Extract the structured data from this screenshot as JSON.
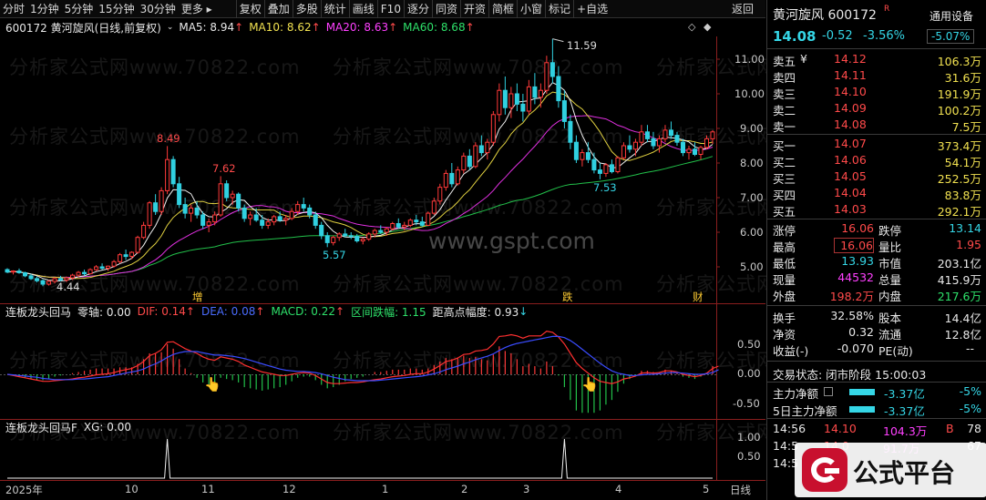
{
  "toolbar": {
    "left": [
      "分时",
      "1分钟",
      "5分钟",
      "15分钟",
      "30分钟",
      "更多 ▸"
    ],
    "right": [
      "复权",
      "叠加",
      "多股",
      "统计",
      "画线",
      "F10",
      "逐分",
      "同资",
      "开资",
      "简框",
      "小窗",
      "标记",
      "+自选"
    ],
    "return": "返回"
  },
  "info": {
    "code_name": "600172 黄河旋风(日线,前复权)",
    "ma5": "MA5: 8.94",
    "ma10": "MA10: 8.62",
    "ma20": "MA20: 8.63",
    "ma60": "MA60: 8.68"
  },
  "watermarks": {
    "text": "分析家公式网www.70822.com",
    "site": "www.gspt.com",
    "logo_text": "公式平台"
  },
  "price_axis": [
    "11.00",
    "10.00",
    "9.00",
    "8.00",
    "7.00",
    "6.00",
    "5.00"
  ],
  "price_labels": [
    "11.59",
    "8.49",
    "7.62",
    "5.57",
    "4.44",
    "7.53"
  ],
  "markers": [
    "增",
    "跌",
    "财"
  ],
  "indicator1": {
    "name": "连板龙头回马",
    "zero": "零轴: 0.00",
    "dif": "DIF: 0.14",
    "dea": "DEA: 0.08",
    "macd": "MACD: 0.22",
    "range": "区间跌幅: 1.15",
    "dist": "距高点幅度: 0.93",
    "axis": [
      "0.50",
      "0.00",
      "-0.50"
    ]
  },
  "indicator2": {
    "name": "连板龙头回马F",
    "xg": "XG: 0.00",
    "axis": [
      "1.00",
      "0.50"
    ]
  },
  "date_axis": [
    "2025年",
    "10",
    "11",
    "12",
    "1",
    "2",
    "3",
    "4",
    "5"
  ],
  "period": "日线",
  "chart_data": {
    "type": "candlestick",
    "y_range": [
      4.2,
      12.0
    ],
    "candles": [
      [
        4.92,
        4.96,
        4.82,
        4.85
      ],
      [
        4.85,
        4.9,
        4.78,
        4.88
      ],
      [
        4.88,
        4.95,
        4.8,
        4.83
      ],
      [
        4.83,
        4.86,
        4.7,
        4.74
      ],
      [
        4.74,
        4.8,
        4.62,
        4.66
      ],
      [
        4.66,
        4.72,
        4.55,
        4.6
      ],
      [
        4.6,
        4.64,
        4.44,
        4.5
      ],
      [
        4.5,
        4.62,
        4.46,
        4.58
      ],
      [
        4.58,
        4.7,
        4.52,
        4.66
      ],
      [
        4.66,
        4.74,
        4.58,
        4.62
      ],
      [
        4.62,
        4.72,
        4.56,
        4.68
      ],
      [
        4.68,
        4.8,
        4.62,
        4.76
      ],
      [
        4.76,
        4.88,
        4.7,
        4.84
      ],
      [
        4.84,
        4.92,
        4.74,
        4.8
      ],
      [
        4.8,
        4.96,
        4.78,
        4.92
      ],
      [
        4.92,
        5.05,
        4.88,
        5.0
      ],
      [
        5.0,
        5.1,
        4.92,
        4.96
      ],
      [
        4.96,
        5.04,
        4.88,
        5.02
      ],
      [
        5.02,
        5.2,
        4.98,
        5.15
      ],
      [
        5.15,
        5.4,
        5.1,
        5.35
      ],
      [
        5.35,
        5.5,
        5.2,
        5.3
      ],
      [
        5.3,
        5.45,
        5.22,
        5.42
      ],
      [
        5.42,
        5.9,
        5.38,
        5.85
      ],
      [
        5.85,
        6.3,
        5.8,
        6.2
      ],
      [
        6.2,
        6.9,
        6.1,
        6.85
      ],
      [
        6.85,
        7.1,
        6.5,
        6.6
      ],
      [
        6.6,
        7.3,
        6.5,
        7.2
      ],
      [
        7.2,
        8.49,
        7.1,
        8.1
      ],
      [
        8.1,
        8.2,
        7.3,
        7.4
      ],
      [
        7.4,
        7.6,
        6.7,
        6.8
      ],
      [
        6.8,
        7.0,
        6.4,
        6.55
      ],
      [
        6.55,
        6.8,
        6.3,
        6.7
      ],
      [
        6.7,
        6.9,
        6.4,
        6.5
      ],
      [
        6.5,
        6.6,
        6.1,
        6.2
      ],
      [
        6.2,
        6.4,
        6.0,
        6.3
      ],
      [
        6.3,
        6.6,
        6.2,
        6.5
      ],
      [
        6.5,
        7.62,
        6.45,
        7.4
      ],
      [
        7.4,
        7.5,
        6.9,
        7.0
      ],
      [
        7.0,
        7.2,
        6.8,
        7.1
      ],
      [
        7.1,
        7.15,
        6.6,
        6.7
      ],
      [
        6.7,
        6.8,
        6.3,
        6.4
      ],
      [
        6.4,
        6.6,
        6.2,
        6.5
      ],
      [
        6.5,
        6.7,
        6.3,
        6.35
      ],
      [
        6.35,
        6.5,
        6.1,
        6.2
      ],
      [
        6.2,
        6.4,
        6.1,
        6.3
      ],
      [
        6.3,
        6.5,
        6.2,
        6.45
      ],
      [
        6.45,
        6.6,
        6.3,
        6.35
      ],
      [
        6.35,
        6.5,
        6.2,
        6.4
      ],
      [
        6.4,
        6.7,
        6.35,
        6.6
      ],
      [
        6.6,
        6.9,
        6.5,
        6.8
      ],
      [
        6.8,
        7.0,
        6.6,
        6.7
      ],
      [
        6.7,
        6.8,
        6.4,
        6.5
      ],
      [
        6.5,
        6.6,
        6.1,
        6.2
      ],
      [
        6.2,
        6.3,
        5.8,
        5.9
      ],
      [
        5.9,
        6.0,
        5.57,
        5.7
      ],
      [
        5.7,
        5.9,
        5.62,
        5.85
      ],
      [
        5.85,
        6.0,
        5.75,
        5.95
      ],
      [
        5.95,
        6.1,
        5.85,
        5.9
      ],
      [
        5.9,
        6.0,
        5.8,
        5.88
      ],
      [
        5.88,
        5.95,
        5.7,
        5.75
      ],
      [
        5.75,
        5.85,
        5.65,
        5.8
      ],
      [
        5.8,
        6.0,
        5.75,
        5.95
      ],
      [
        5.95,
        6.1,
        5.85,
        6.05
      ],
      [
        6.05,
        6.2,
        5.95,
        6.0
      ],
      [
        6.0,
        6.15,
        5.9,
        6.1
      ],
      [
        6.1,
        6.3,
        6.05,
        6.25
      ],
      [
        6.25,
        6.4,
        6.1,
        6.15
      ],
      [
        6.15,
        6.3,
        6.05,
        6.2
      ],
      [
        6.2,
        6.4,
        6.15,
        6.35
      ],
      [
        6.35,
        6.5,
        6.2,
        6.3
      ],
      [
        6.3,
        6.45,
        6.15,
        6.2
      ],
      [
        6.2,
        6.6,
        6.18,
        6.55
      ],
      [
        6.55,
        7.0,
        6.5,
        6.9
      ],
      [
        6.9,
        7.4,
        6.8,
        7.3
      ],
      [
        7.3,
        7.8,
        7.2,
        7.7
      ],
      [
        7.7,
        8.0,
        7.3,
        7.4
      ],
      [
        7.4,
        7.9,
        7.35,
        7.8
      ],
      [
        7.8,
        8.3,
        7.7,
        8.2
      ],
      [
        8.2,
        8.4,
        7.8,
        7.9
      ],
      [
        7.9,
        8.6,
        7.85,
        8.5
      ],
      [
        8.5,
        8.8,
        8.2,
        8.3
      ],
      [
        8.3,
        8.7,
        8.1,
        8.6
      ],
      [
        8.6,
        9.5,
        8.5,
        9.4
      ],
      [
        9.4,
        10.3,
        9.2,
        10.1
      ],
      [
        10.1,
        10.5,
        9.4,
        9.6
      ],
      [
        9.6,
        10.2,
        9.3,
        10.0
      ],
      [
        10.0,
        10.3,
        9.5,
        9.7
      ],
      [
        9.7,
        10.0,
        9.2,
        9.5
      ],
      [
        9.5,
        10.4,
        9.4,
        10.2
      ],
      [
        10.2,
        10.6,
        9.7,
        9.9
      ],
      [
        9.9,
        10.3,
        9.6,
        10.1
      ],
      [
        10.1,
        11.1,
        10.0,
        10.9
      ],
      [
        10.9,
        11.59,
        10.3,
        10.5
      ],
      [
        10.5,
        10.8,
        9.6,
        9.8
      ],
      [
        9.8,
        10.1,
        9.0,
        9.2
      ],
      [
        9.2,
        9.4,
        8.4,
        8.6
      ],
      [
        8.6,
        8.8,
        8.0,
        8.1
      ],
      [
        8.1,
        8.4,
        7.9,
        8.3
      ],
      [
        8.3,
        8.6,
        8.0,
        8.1
      ],
      [
        8.1,
        8.3,
        7.7,
        7.8
      ],
      [
        7.8,
        8.0,
        7.53,
        7.7
      ],
      [
        7.7,
        8.0,
        7.6,
        7.95
      ],
      [
        7.95,
        8.1,
        7.7,
        7.75
      ],
      [
        7.75,
        8.2,
        7.7,
        8.15
      ],
      [
        8.15,
        8.6,
        8.1,
        8.5
      ],
      [
        8.5,
        8.8,
        8.3,
        8.4
      ],
      [
        8.4,
        8.7,
        8.2,
        8.6
      ],
      [
        8.6,
        9.1,
        8.5,
        8.9
      ],
      [
        8.9,
        9.1,
        8.6,
        8.7
      ],
      [
        8.7,
        8.9,
        8.4,
        8.5
      ],
      [
        8.5,
        8.8,
        8.3,
        8.7
      ],
      [
        8.7,
        9.1,
        8.6,
        8.95
      ],
      [
        8.95,
        9.2,
        8.7,
        8.8
      ],
      [
        8.8,
        8.9,
        8.5,
        8.6
      ],
      [
        8.6,
        8.7,
        8.2,
        8.3
      ],
      [
        8.3,
        8.5,
        8.1,
        8.4
      ],
      [
        8.4,
        8.6,
        8.2,
        8.25
      ],
      [
        8.25,
        8.5,
        8.1,
        8.45
      ],
      [
        8.45,
        8.8,
        8.4,
        8.7
      ],
      [
        8.7,
        8.95,
        8.55,
        8.9
      ]
    ],
    "dif": [
      0.0,
      -0.02,
      -0.04,
      -0.06,
      -0.08,
      -0.1,
      -0.12,
      -0.12,
      -0.11,
      -0.1,
      -0.09,
      -0.08,
      -0.06,
      -0.05,
      -0.03,
      -0.01,
      0.0,
      0.01,
      0.03,
      0.06,
      0.08,
      0.1,
      0.15,
      0.22,
      0.32,
      0.36,
      0.42,
      0.55,
      0.56,
      0.5,
      0.44,
      0.4,
      0.36,
      0.3,
      0.26,
      0.24,
      0.3,
      0.28,
      0.26,
      0.22,
      0.16,
      0.12,
      0.08,
      0.04,
      0.02,
      0.0,
      -0.02,
      -0.02,
      0.0,
      0.02,
      0.03,
      0.02,
      -0.02,
      -0.08,
      -0.14,
      -0.16,
      -0.16,
      -0.15,
      -0.14,
      -0.14,
      -0.13,
      -0.11,
      -0.09,
      -0.08,
      -0.06,
      -0.04,
      -0.03,
      -0.02,
      0.0,
      0.01,
      0.01,
      0.04,
      0.09,
      0.15,
      0.22,
      0.24,
      0.28,
      0.34,
      0.35,
      0.4,
      0.41,
      0.43,
      0.52,
      0.65,
      0.66,
      0.68,
      0.66,
      0.62,
      0.66,
      0.66,
      0.66,
      0.74,
      0.72,
      0.64,
      0.52,
      0.36,
      0.2,
      0.1,
      0.02,
      -0.06,
      -0.12,
      -0.14,
      -0.16,
      -0.13,
      -0.08,
      -0.06,
      -0.03,
      0.02,
      0.03,
      0.02,
      0.03,
      0.06,
      0.06,
      0.04,
      0.0,
      -0.02,
      -0.04,
      -0.02,
      0.02,
      0.1,
      0.14
    ],
    "dea": [
      0.0,
      -0.01,
      -0.02,
      -0.03,
      -0.04,
      -0.05,
      -0.07,
      -0.08,
      -0.09,
      -0.09,
      -0.09,
      -0.09,
      -0.08,
      -0.08,
      -0.07,
      -0.06,
      -0.05,
      -0.04,
      -0.02,
      0.0,
      0.02,
      0.04,
      0.06,
      0.09,
      0.14,
      0.18,
      0.23,
      0.29,
      0.34,
      0.37,
      0.39,
      0.39,
      0.39,
      0.37,
      0.35,
      0.33,
      0.33,
      0.32,
      0.31,
      0.29,
      0.27,
      0.24,
      0.21,
      0.18,
      0.15,
      0.12,
      0.09,
      0.07,
      0.06,
      0.05,
      0.05,
      0.04,
      0.03,
      0.01,
      -0.02,
      -0.05,
      -0.07,
      -0.09,
      -0.1,
      -0.11,
      -0.11,
      -0.11,
      -0.11,
      -0.1,
      -0.09,
      -0.08,
      -0.07,
      -0.06,
      -0.05,
      -0.04,
      -0.03,
      -0.01,
      0.01,
      0.04,
      0.08,
      0.11,
      0.14,
      0.18,
      0.21,
      0.25,
      0.28,
      0.31,
      0.35,
      0.41,
      0.46,
      0.5,
      0.53,
      0.55,
      0.57,
      0.59,
      0.61,
      0.63,
      0.65,
      0.65,
      0.63,
      0.58,
      0.51,
      0.43,
      0.35,
      0.27,
      0.19,
      0.12,
      0.06,
      0.02,
      0.0,
      -0.02,
      -0.02,
      -0.01,
      0.0,
      0.0,
      0.01,
      0.02,
      0.03,
      0.03,
      0.02,
      0.01,
      0.0,
      0.0,
      0.01,
      0.03,
      0.08
    ],
    "xg_peaks": [
      27,
      94
    ]
  },
  "panel": {
    "title": "黄河旋风 600172",
    "device": "通用设备",
    "price": "14.08",
    "change": "-0.52",
    "pct": "-3.56%",
    "box_pct": "-5.07%",
    "asks": [
      {
        "label": "卖五",
        "price": "14.12",
        "vol": "106.3万"
      },
      {
        "label": "卖四",
        "price": "14.11",
        "vol": "31.6万"
      },
      {
        "label": "卖三",
        "price": "14.10",
        "vol": "191.9万"
      },
      {
        "label": "卖二",
        "price": "14.09",
        "vol": "100.2万"
      },
      {
        "label": "卖一",
        "price": "14.08",
        "vol": "7.5万"
      }
    ],
    "bids": [
      {
        "label": "买一",
        "price": "14.07",
        "vol": "373.4万"
      },
      {
        "label": "买二",
        "price": "14.06",
        "vol": "54.1万"
      },
      {
        "label": "买三",
        "price": "14.05",
        "vol": "252.5万"
      },
      {
        "label": "买四",
        "price": "14.04",
        "vol": "83.8万"
      },
      {
        "label": "买五",
        "price": "14.03",
        "vol": "292.1万"
      }
    ],
    "stats": [
      {
        "l1": "涨停",
        "v1": "16.06",
        "l2": "跌停",
        "v2": "13.14"
      },
      {
        "l1": "最高",
        "v1": "16.06",
        "l2": "量比",
        "v2": "1.95"
      },
      {
        "l1": "最低",
        "v1": "13.93",
        "l2": "市值",
        "v2": "203.1亿"
      },
      {
        "l1": "现量",
        "v1": "44532",
        "l2": "总量",
        "v2": "415.9万"
      },
      {
        "l1": "外盘",
        "v1": "198.2万",
        "l2": "内盘",
        "v2": "217.6万"
      }
    ],
    "fin": [
      {
        "l1": "换手",
        "v1": "32.58%",
        "l2": "股本",
        "v2": "14.4亿"
      },
      {
        "l1": "净资",
        "v1": "0.32",
        "l2": "流通",
        "v2": "12.8亿"
      },
      {
        "l1": "收益(-)",
        "v1": "-0.070",
        "l2": "PE(动)",
        "v2": "--"
      }
    ],
    "trade_status": "交易状态: 闭市阶段 15:00:03",
    "flow": [
      {
        "label": "主力净额",
        "value": "-3.37亿",
        "pct": "-5%"
      },
      {
        "label": "5日主力净额",
        "value": "-3.37亿",
        "pct": "-5%"
      }
    ],
    "ticks": [
      {
        "time": "14:56",
        "price": "14.10",
        "vol": "104.3万",
        "side": "B",
        "n": "78"
      },
      {
        "time": "14:5",
        "price": "14.0",
        "vol": "91.7万",
        "side": "",
        "n": "67"
      },
      {
        "time": "14:5",
        "price": "",
        "vol": "",
        "side": "",
        "n": ""
      }
    ]
  }
}
